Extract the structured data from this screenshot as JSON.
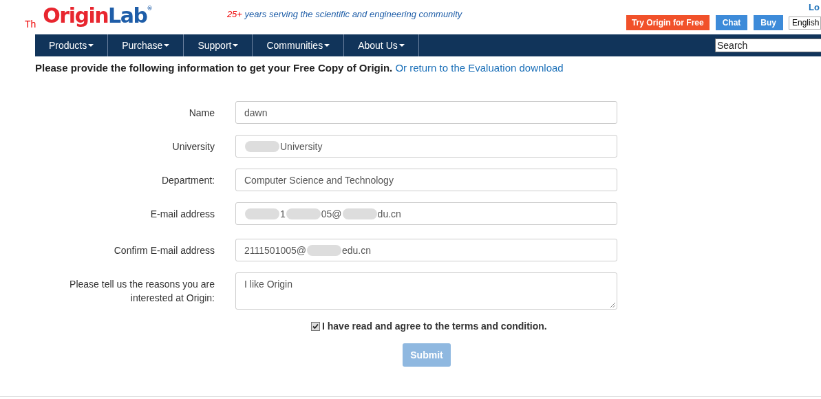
{
  "header": {
    "intro_fragment": "Th",
    "logo": {
      "part1": "Origin",
      "part2": "Lab",
      "mark": "®"
    },
    "tagline_number": "25+",
    "tagline": "years serving the scientific and engineering community",
    "login_fragment": "Lo",
    "buttons": [
      {
        "label": "Try Origin for Free",
        "kind": "primary"
      },
      {
        "label": "Chat",
        "kind": "secondary"
      },
      {
        "label": "Buy",
        "kind": "secondary"
      }
    ],
    "language": "English"
  },
  "nav": {
    "items": [
      {
        "label": "Products"
      },
      {
        "label": "Purchase"
      },
      {
        "label": "Support"
      },
      {
        "label": "Communities"
      },
      {
        "label": "About Us"
      }
    ],
    "search": {
      "placeholder": "Search"
    }
  },
  "heading": {
    "text": "Please provide the following information to get your Free Copy of Origin.",
    "link": "Or return to the Evaluation download"
  },
  "form": {
    "fields": [
      {
        "label": "Name",
        "kind": "input",
        "value": [
          {
            "kind": "text",
            "text": "dawn"
          }
        ]
      },
      {
        "label": "University",
        "kind": "input",
        "value": [
          {
            "kind": "blur"
          },
          {
            "kind": "text",
            "text": "University"
          }
        ]
      },
      {
        "label": "Department:",
        "kind": "input",
        "value": [
          {
            "kind": "text",
            "text": "Computer Science and Technology"
          }
        ]
      },
      {
        "label": "E-mail address",
        "kind": "input",
        "value": [
          {
            "kind": "blur"
          },
          {
            "kind": "text",
            "text": "1"
          },
          {
            "kind": "blur"
          },
          {
            "kind": "text",
            "text": "05@"
          },
          {
            "kind": "blur"
          },
          {
            "kind": "text",
            "text": "du.cn"
          }
        ]
      },
      {
        "label": "Confirm E-mail address",
        "kind": "input",
        "value": [
          {
            "kind": "text",
            "text": "2111501005@"
          },
          {
            "kind": "blur"
          },
          {
            "kind": "text",
            "text": "edu.cn"
          }
        ]
      },
      {
        "label": "Please tell us the reasons you are interested at Origin:",
        "kind": "textarea",
        "value": [
          {
            "kind": "text",
            "text": "I like Origin"
          }
        ]
      }
    ],
    "agree": {
      "label": "I have read and agree to the terms and condition.",
      "checked": true
    },
    "submit": {
      "label": "Submit",
      "disabled": true
    }
  }
}
